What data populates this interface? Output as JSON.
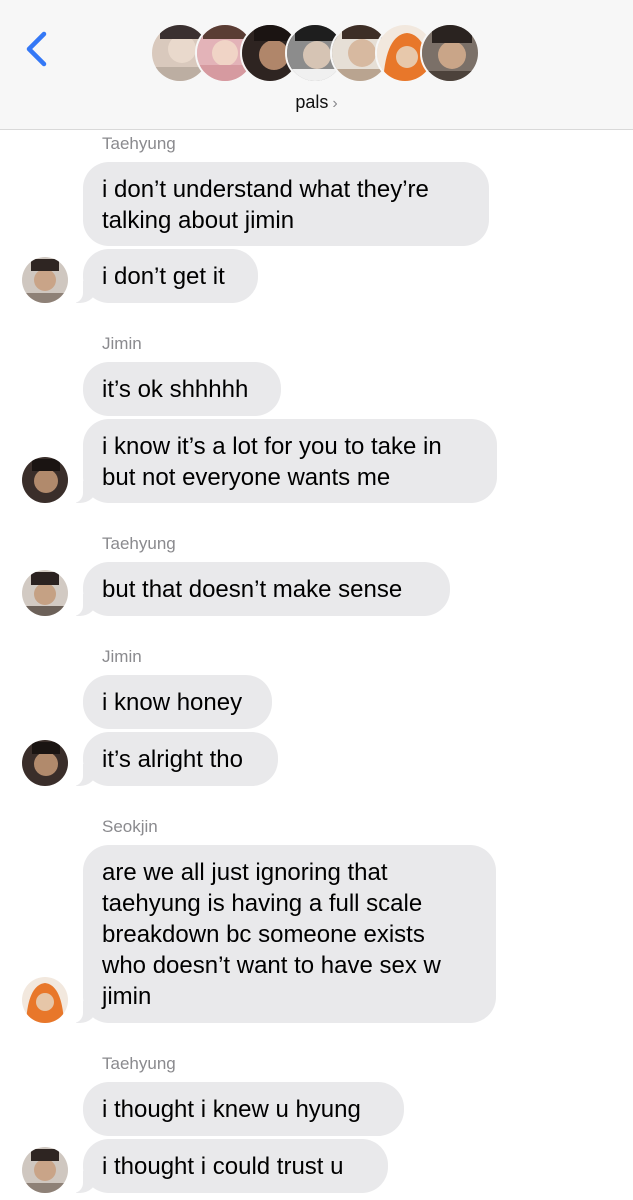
{
  "header": {
    "group_name": "pals",
    "chevron": "›",
    "back_icon": "chevron-left-icon",
    "avatars": [
      {
        "member": "1",
        "color": "#c9b7a9"
      },
      {
        "member": "2",
        "color": "#d9a5a9"
      },
      {
        "member": "3",
        "color": "#6b4b3a"
      },
      {
        "member": "4",
        "color": "#5a5a5a"
      },
      {
        "member": "5",
        "color": "#cbb8a8"
      },
      {
        "member": "6",
        "color": "#e07b2b"
      },
      {
        "member": "7",
        "color": "#4a4038"
      }
    ]
  },
  "messages": {
    "s1": "Taehyung",
    "m1": "i don’t understand what they’re",
    "m1b": "talking about jimin",
    "m2": "i don’t get it",
    "s2": "Jimin",
    "m3": "it’s ok shhhhh",
    "m4": "i know it’s a lot for you to take in",
    "m4b": "but not everyone wants me",
    "s3": "Taehyung",
    "m5": "but that doesn’t make sense",
    "s4": "Jimin",
    "m6": "i know honey",
    "m7": "it’s alright tho",
    "s5": "Seokjin",
    "m8a": "are we all just ignoring that",
    "m8b": "taehyung is having a full scale",
    "m8c": "breakdown bc someone exists",
    "m8d": "who doesn’t want to have sex w",
    "m8e": "jimin",
    "s6": "Taehyung",
    "m9": "i thought i knew u hyung",
    "m10": "i thought i could trust u"
  },
  "colors": {
    "bubble": "#e9e9eb",
    "accent": "#3478f6",
    "sender": "#8a8a8e"
  }
}
